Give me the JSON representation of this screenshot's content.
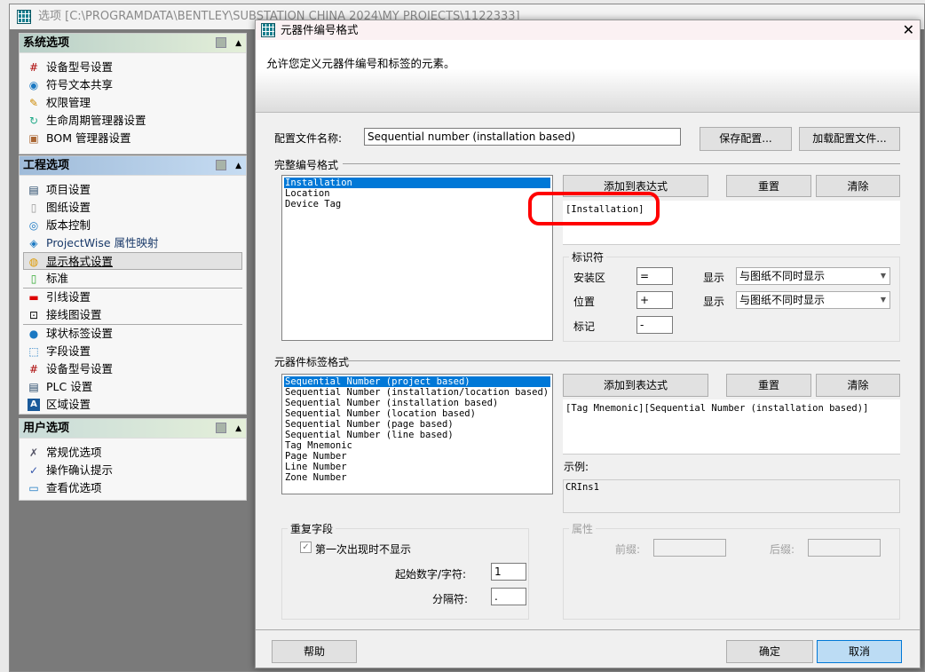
{
  "options_window": {
    "title": "选项 [C:\\PROGRAMDATA\\BENTLEY\\SUBSTATION CHINA 2024\\MY PROJECTS\\1122333]"
  },
  "sidebar": {
    "system": {
      "title": "系统选项",
      "items": [
        "设备型号设置",
        "符号文本共享",
        "权限管理",
        "生命周期管理器设置",
        "BOM 管理器设置"
      ]
    },
    "project": {
      "title": "工程选项",
      "items": [
        "项目设置",
        "图纸设置",
        "版本控制",
        "ProjectWise 属性映射",
        "显示格式设置",
        "标准",
        "引线设置",
        "接线图设置",
        "球状标签设置",
        "字段设置",
        "设备型号设置",
        "PLC 设置",
        "区域设置"
      ]
    },
    "user": {
      "title": "用户选项",
      "items": [
        "常规优选项",
        "操作确认提示",
        "查看优选项"
      ]
    }
  },
  "dialog": {
    "title": "元器件编号格式",
    "description": "允许您定义元器件编号和标签的元素。",
    "config_label": "配置文件名称:",
    "config_value": "Sequential number (installation based)",
    "save_config": "保存配置...",
    "load_config": "加载配置文件...",
    "full_format": {
      "title": "完整编号格式",
      "items": [
        "Installation",
        "Location",
        "Device Tag"
      ],
      "add": "添加到表达式",
      "reset": "重置",
      "clear": "清除",
      "expression": "[Installation]",
      "identifier": {
        "title": "标识符",
        "install_label": "安装区",
        "install_value": "=",
        "show1": "显示",
        "show1_value": "与图纸不同时显示",
        "location_label": "位置",
        "location_value": "+",
        "show2": "显示",
        "show2_value": "与图纸不同时显示",
        "tag_label": "标记",
        "tag_value": "-"
      }
    },
    "label_format": {
      "title": "元器件标签格式",
      "items": [
        "Sequential Number (project based)",
        "Sequential Number (installation/location based)",
        "Sequential Number (installation based)",
        "Sequential Number (location based)",
        "Sequential Number (page based)",
        "Sequential Number (line based)",
        "Tag Mnemonic",
        "Page Number",
        "Line Number",
        "Zone Number"
      ],
      "add": "添加到表达式",
      "reset": "重置",
      "clear": "清除",
      "expression": "[Tag Mnemonic][Sequential Number (installation based)]",
      "example_label": "示例:",
      "example_value": "CRIns1"
    },
    "repeat": {
      "title": "重复字段",
      "checkbox": "第一次出现时不显示",
      "checked": true,
      "start_label": "起始数字/字符:",
      "start_value": "1",
      "sep_label": "分隔符:",
      "sep_value": "."
    },
    "attr": {
      "title": "属性",
      "prefix": "前缀:",
      "suffix": "后缀:"
    },
    "help": "帮助",
    "ok": "确定",
    "cancel": "取消"
  },
  "colors": {
    "selection": "#0078d7",
    "annotation": "#ff0000"
  }
}
